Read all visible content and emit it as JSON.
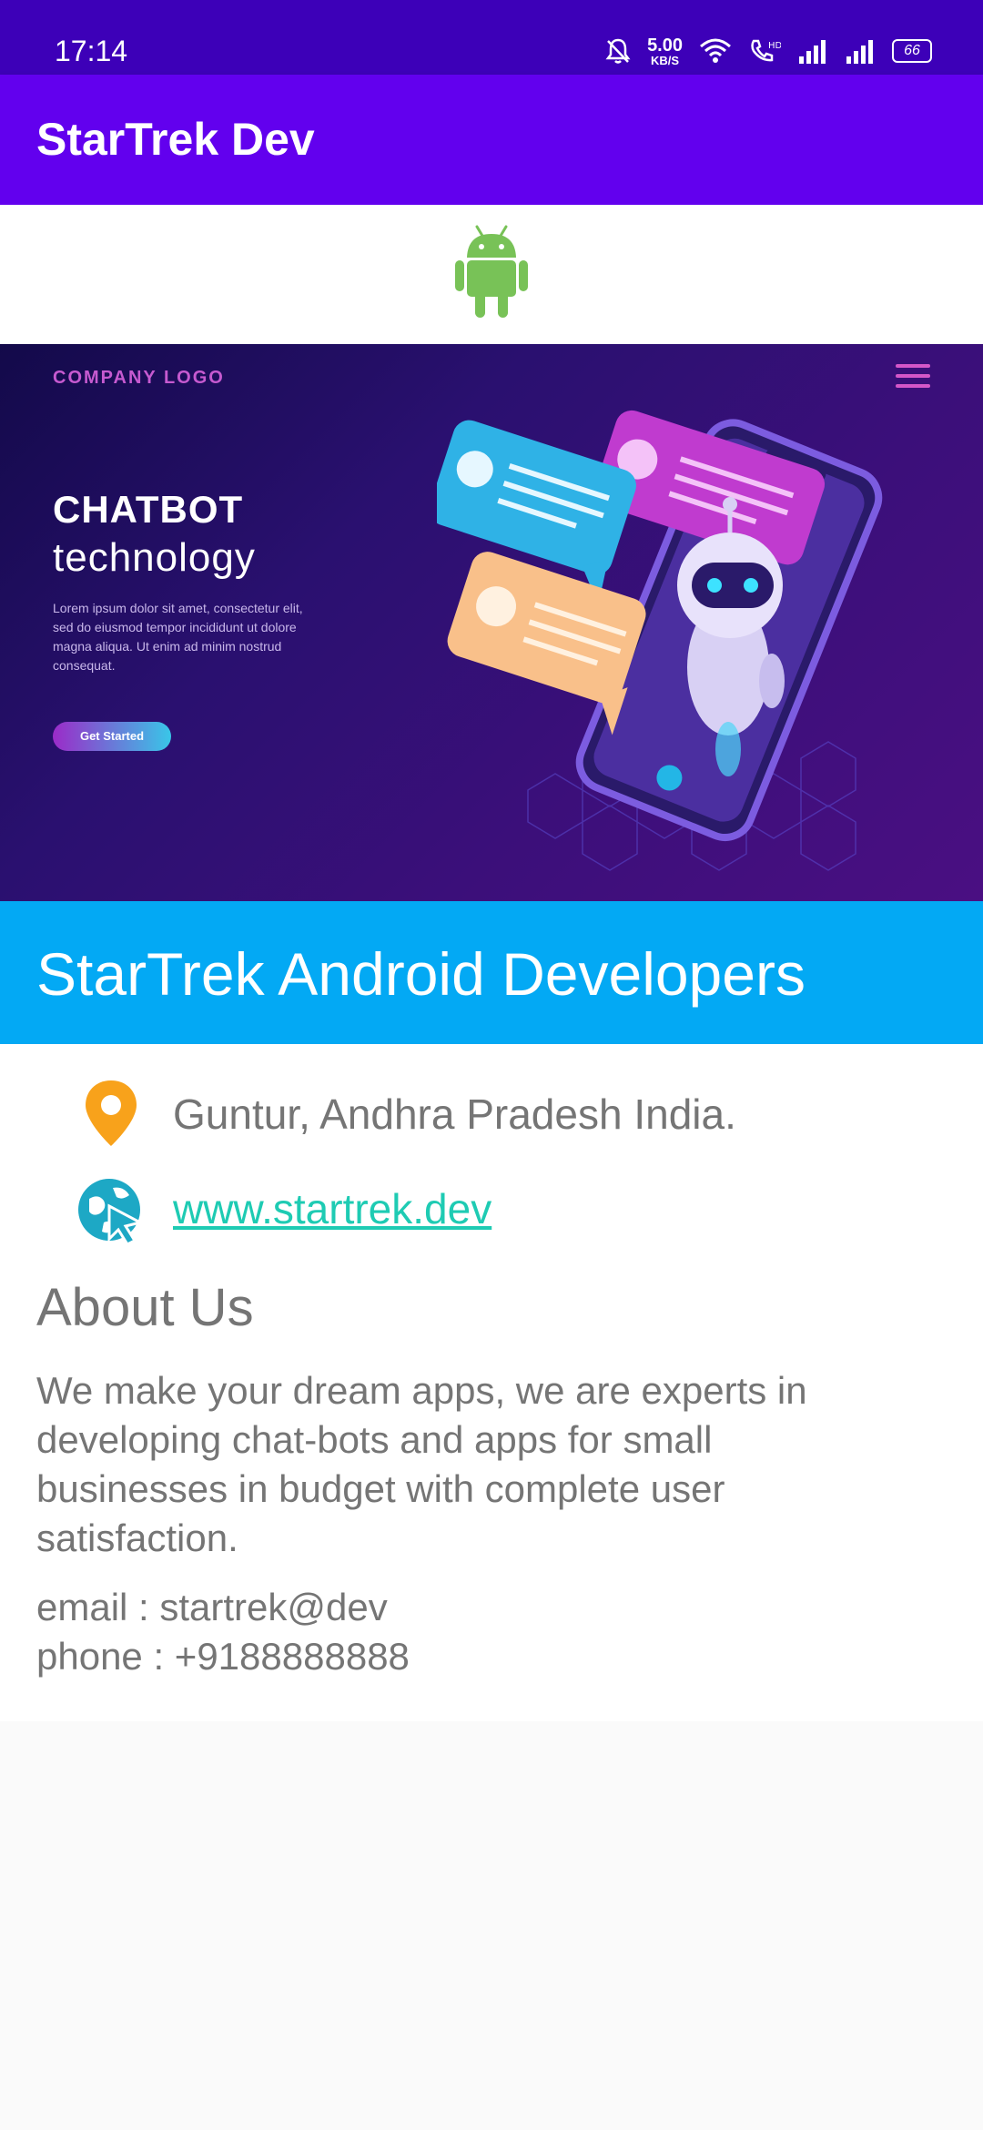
{
  "status_bar": {
    "time": "17:14",
    "net_speed_value": "5.00",
    "net_speed_unit": "KB/S",
    "battery": "66",
    "icons": [
      "bell-off-icon",
      "wifi-icon",
      "call-icon",
      "signal-icon",
      "signal-icon",
      "battery-icon"
    ]
  },
  "app_bar": {
    "title": "StarTrek Dev",
    "color": "#6200ee"
  },
  "banner": {
    "company_logo": "COMPANY LOGO",
    "heading_bold": "CHATBOT",
    "heading_light": "technology",
    "lorem": "Lorem ipsum dolor sit amet, consectetur elit, sed do eiusmod tempor incididunt ut dolore magna aliqua. Ut enim ad minim nostrud consequat.",
    "button": "Get Started"
  },
  "company": {
    "name": "StarTrek Android Developers",
    "band_color": "#03a9f4"
  },
  "info": {
    "location": "Guntur, Andhra Pradesh India.",
    "website": "www.startrek.dev",
    "about_title": "About Us",
    "about_body": "We make your dream apps, we are experts in developing chat-bots and apps for small businesses in budget with complete user satisfaction.",
    "email": "email : startrek@dev",
    "phone": "phone : +9188888888"
  }
}
